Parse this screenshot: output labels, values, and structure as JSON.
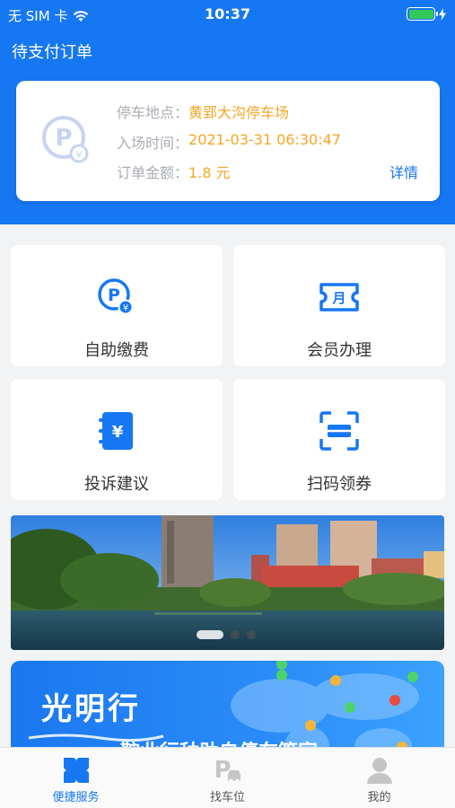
{
  "status_bar": {
    "carrier": "无 SIM 卡",
    "time": "10:37"
  },
  "header": {
    "title": "待支付订单"
  },
  "order": {
    "location_label": "停车地点：",
    "location_value": "黄郢大沟停车场",
    "entry_label": "入场时间：",
    "entry_value": "2021-03-31 06:30:47",
    "amount_label": "订单金额：",
    "amount_value": "1.8 元",
    "detail_link": "详情"
  },
  "services": [
    {
      "label": "自助缴费",
      "icon": "parking-pay-icon"
    },
    {
      "label": "会员办理",
      "icon": "monthly-ticket-icon"
    },
    {
      "label": "投诉建议",
      "icon": "feedback-book-icon"
    },
    {
      "label": "扫码领券",
      "icon": "scan-coupon-icon"
    }
  ],
  "banner": {
    "slides": 3,
    "active_slide": 1
  },
  "promo": {
    "title": "光明行",
    "subtitle": "鞍业行种助自停车管家"
  },
  "tabbar": {
    "items": [
      {
        "label": "便捷服务",
        "active": true
      },
      {
        "label": "找车位",
        "active": false
      },
      {
        "label": "我的",
        "active": false
      }
    ]
  },
  "colors": {
    "brand_blue": "#1677f2",
    "order_value": "#f5a623",
    "label_gray": "#a9adb3",
    "tab_active": "#1677f2",
    "tab_inactive": "#555555"
  }
}
